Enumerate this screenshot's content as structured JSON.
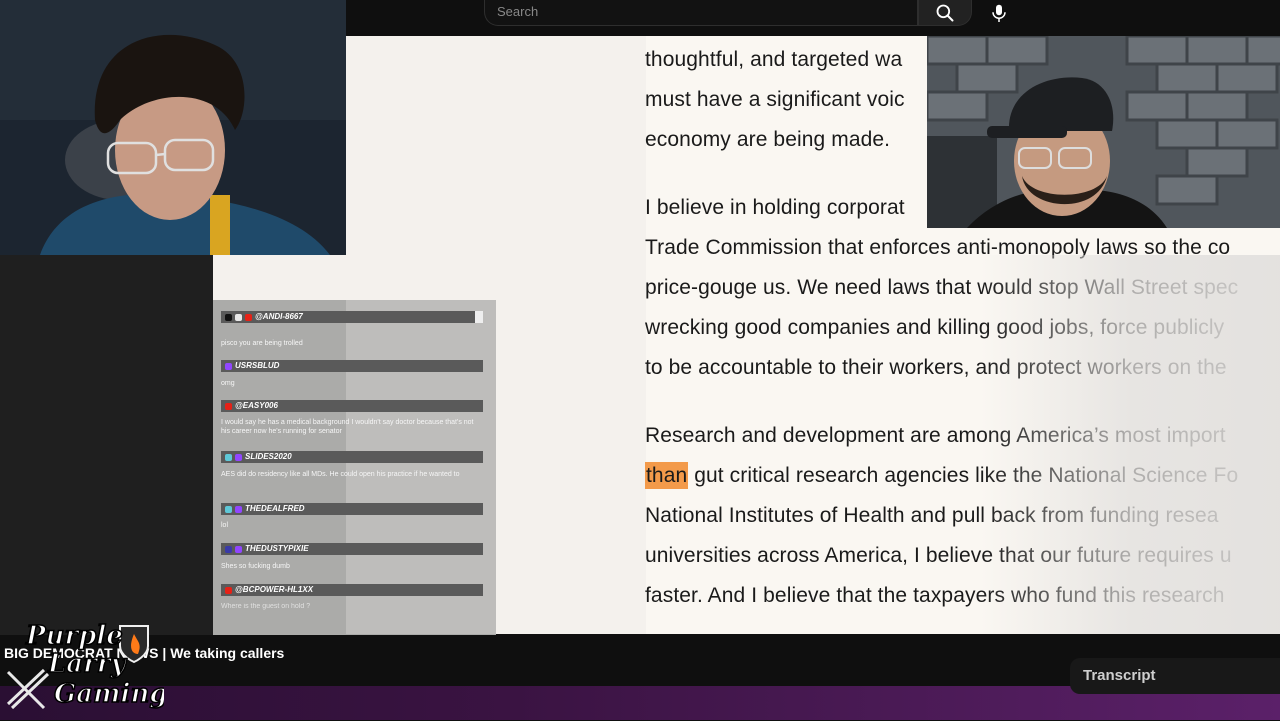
{
  "search": {
    "placeholder": "Search"
  },
  "article": {
    "lines": [
      "thoughtful, and targeted wa",
      "must have a significant voic",
      "economy are being made.",
      "I believe in holding corporat",
      "Trade Commission that enforces anti-monopoly laws so the co",
      "price-gouge us. We need laws that would stop Wall Street spec",
      "wrecking good companies and killing good jobs, force publicly",
      "to be accountable to their workers, and protect workers on the",
      "Research and development are among America’s most import",
      "than",
      " gut critical research agencies like the National Science Fo",
      "National Institutes of Health and pull back from funding resea",
      "universities across America, I believe that our future requires u",
      "faster. And I believe that the taxpayers who fund this research"
    ],
    "highlight_color": "#f39a4a"
  },
  "chat": {
    "messages": [
      {
        "user": "@ANDI-8667",
        "text": "pisco you are being trolled"
      },
      {
        "user": "USRSBLUD",
        "text": "omg"
      },
      {
        "user": "@EASY006",
        "text": "I would say he has a medical background I wouldn't say doctor because that's not his career now he's running for senator"
      },
      {
        "user": "SLIDES2020",
        "text": "AES did do residency like all MDs. He could open his practice if he wanted to"
      },
      {
        "user": "THEDEALFRED",
        "text": "lol"
      },
      {
        "user": "THEDUSTYPIXIE",
        "text": "Shes so fucking dumb"
      },
      {
        "user": "@BCPOWER-HL1XX",
        "text": "Where is the guest on hold ?"
      }
    ]
  },
  "ticker": {
    "text": "BIG DEMOCRAT NEWS | We taking callers"
  },
  "transcript": {
    "label": "Transcript"
  },
  "logo": {
    "line1": "Purple",
    "line2": "Larry",
    "line3": "Gaming"
  },
  "colors": {
    "purple": "#4a1a55",
    "youtube_red": "#e62117",
    "twitch_purple": "#9146ff"
  }
}
